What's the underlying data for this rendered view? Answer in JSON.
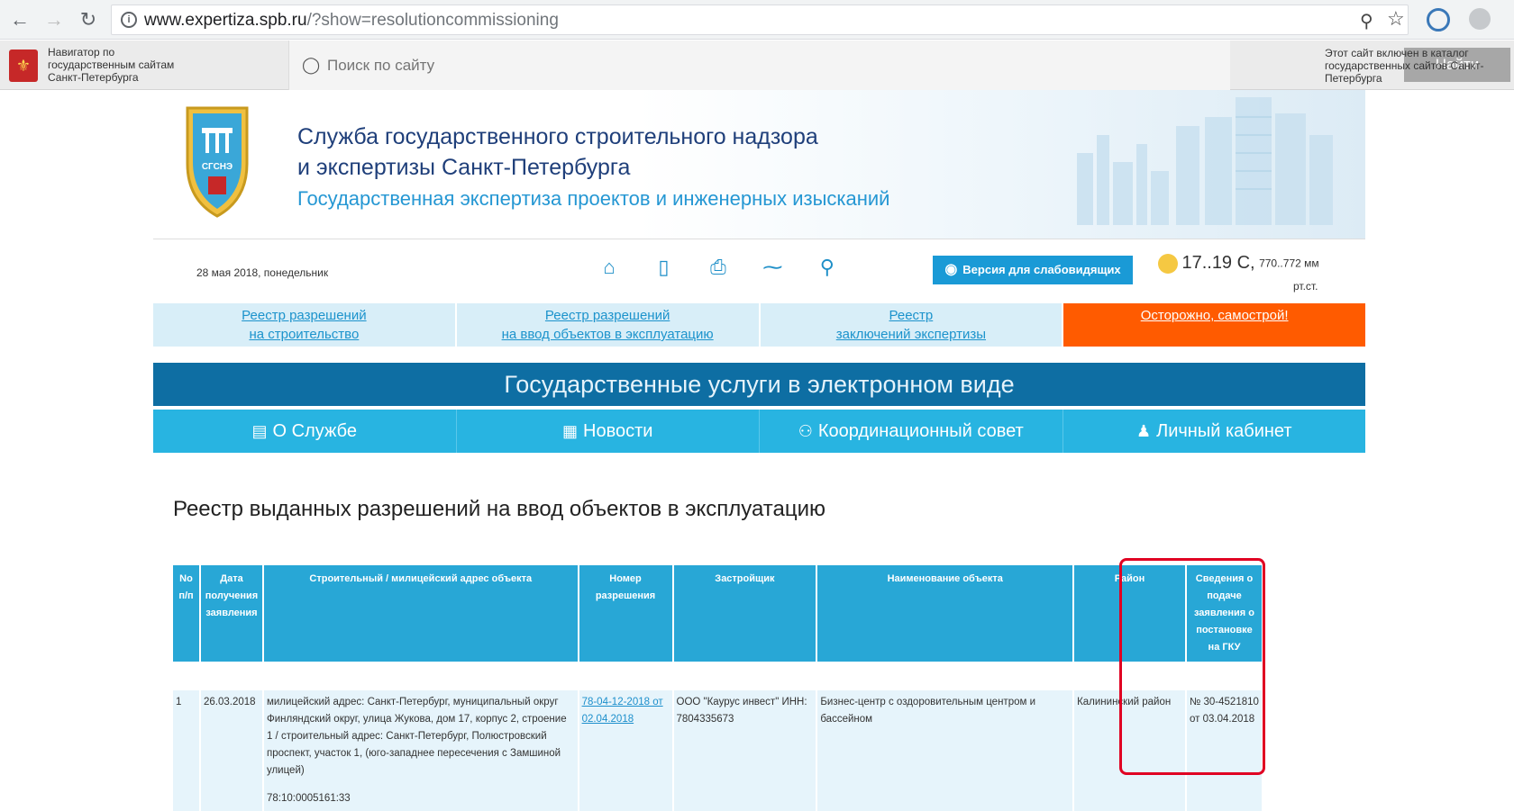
{
  "browser": {
    "url_host": "www.expertiza.spb.ru",
    "url_path": "/?show=resolutioncommissioning"
  },
  "govbar": {
    "navigator_text": "Навигатор по государственным сайтам Санкт-Петербурга",
    "search_placeholder": "Поиск по сайту",
    "find_button": "Найти",
    "catalog_text": "Этот сайт включен в каталог государственных сайтов Санкт-Петербурга"
  },
  "header": {
    "title_line1": "Служба государственного строительного надзора",
    "title_line2": "и экспертизы Санкт-Петербурга",
    "subtitle": "Государственная экспертиза проектов и инженерных изысканий",
    "logo_text": "СГСНЭ"
  },
  "toolbar": {
    "date": "28 мая 2018, понедельник",
    "vision_button": "Версия для слабовидящих",
    "temperature": "17..19 С,",
    "pressure": "770..772 мм",
    "pressure_unit": "рт.ст."
  },
  "registry_links": [
    {
      "line1": "Реестр разрешений",
      "line2": "на строительство"
    },
    {
      "line1": "Реестр разрешений",
      "line2": "на ввод объектов в эксплуатацию"
    },
    {
      "line1": "Реестр",
      "line2": "заключений экспертизы"
    },
    {
      "line1": "Осторожно, самострой!",
      "line2": ""
    }
  ],
  "gos_banner": "Государственные услуги в электронном виде",
  "menu": [
    "О Службе",
    "Новости",
    "Координационный совет",
    "Личный кабинет"
  ],
  "page_title": "Реестр выданных разрешений на ввод объектов в эксплуатацию",
  "table": {
    "headers": [
      "No п/п",
      "Дата получения заявления",
      "Строительный / милицейский адрес объекта",
      "Номер разрешения",
      "Застройщик",
      "Наименование объекта",
      "Район",
      "Сведения о подаче заявления о постановке на ГКУ"
    ],
    "rows": [
      {
        "num": "1",
        "date": "26.03.2018",
        "address": "милицейский адрес: Санкт-Петербург, муниципальный округ Финляндский округ, улица Жукова, дом 17, корпус 2, строение 1 / строительный адрес: Санкт-Петербург, Полюстровский проспект, участок 1, (юго-западнее пересечения с Замшиной улицей)",
        "cadastral": "78:10:0005161:33",
        "permit": "78-04-12-2018 от 02.04.2018",
        "developer": "ООО \"Каурус инвест\" ИНН: 7804335673",
        "object": "Бизнес-центр с оздоровительным центром и бассейном",
        "district": "Калининский район",
        "gku": "№ 30-4521810 от 03.04.2018"
      }
    ]
  }
}
